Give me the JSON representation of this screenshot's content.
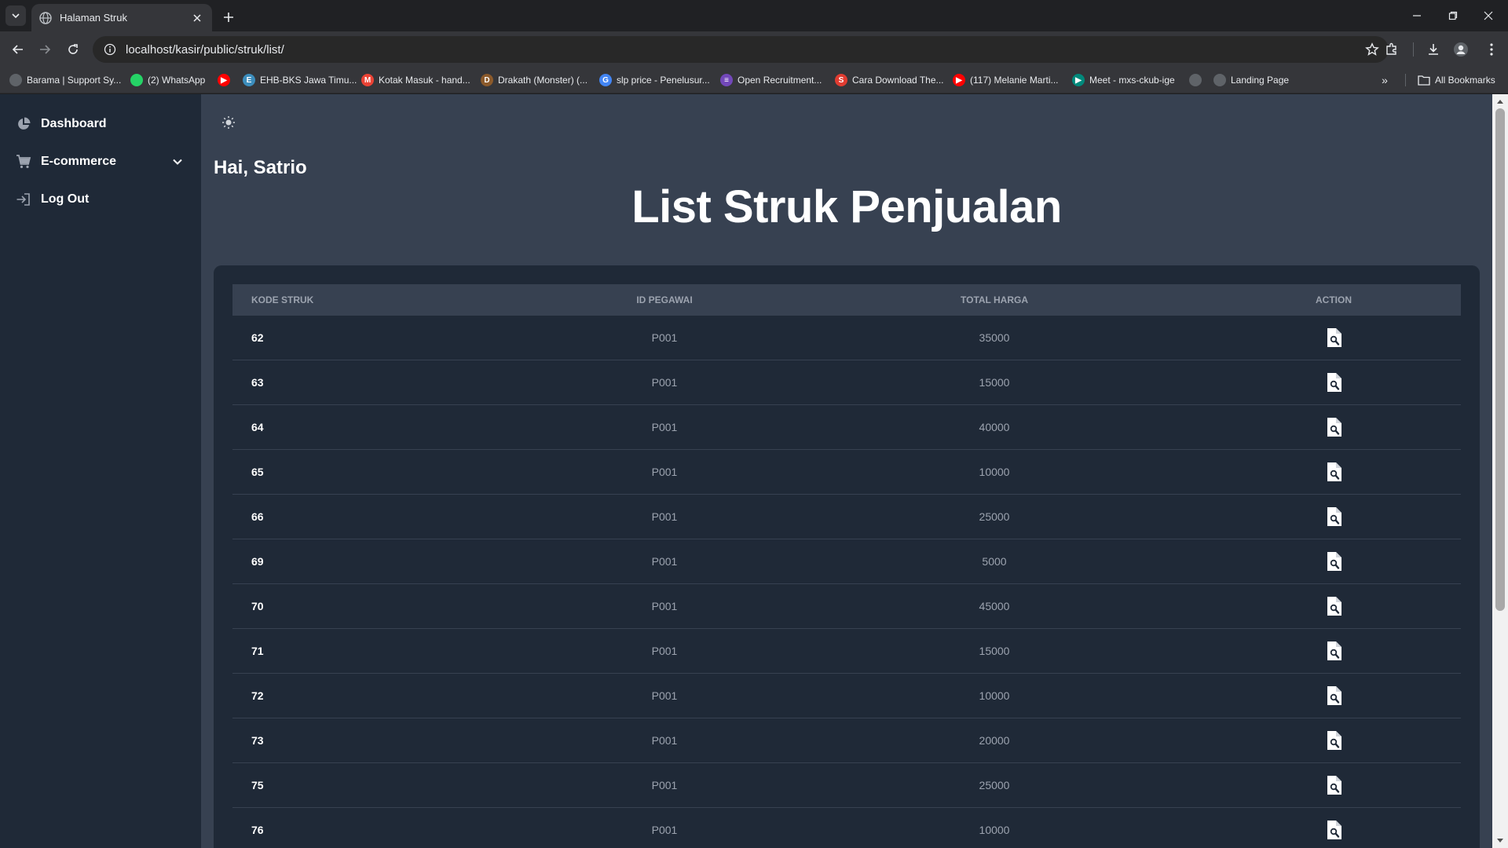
{
  "browser": {
    "tab_title": "Halaman Struk",
    "url": "localhost/kasir/public/struk/list/",
    "bookmarks": [
      {
        "label": "Barama | Support Sy...",
        "icon": "globe-icon",
        "color": "#5f6368"
      },
      {
        "label": "(2) WhatsApp",
        "icon": "whatsapp-icon",
        "color": "#25d366"
      },
      {
        "label": "",
        "icon": "youtube-icon",
        "color": "#ff0000"
      },
      {
        "label": "EHB-BKS Jawa Timu...",
        "icon": "site-icon",
        "color": "#3c8dbc"
      },
      {
        "label": "Kotak Masuk - hand...",
        "icon": "gmail-icon",
        "color": "#ea4335"
      },
      {
        "label": "Drakath (Monster) (...",
        "icon": "game-icon",
        "color": "#8b5a2b"
      },
      {
        "label": "slp price - Penelusur...",
        "icon": "google-icon",
        "color": "#4285f4"
      },
      {
        "label": "Open Recruitment...",
        "icon": "forms-icon",
        "color": "#7248b9"
      },
      {
        "label": "Cara Download The...",
        "icon": "s-icon",
        "color": "#e03c31"
      },
      {
        "label": "(117) Melanie Marti...",
        "icon": "youtube-icon",
        "color": "#ff0000"
      },
      {
        "label": "Meet - mxs-ckub-ige",
        "icon": "meet-icon",
        "color": "#00897b"
      },
      {
        "label": "",
        "icon": "globe-icon",
        "color": "#5f6368"
      },
      {
        "label": "Landing Page",
        "icon": "globe-icon",
        "color": "#5f6368"
      }
    ],
    "all_bookmarks_label": "All Bookmarks"
  },
  "sidebar": {
    "items": [
      {
        "label": "Dashboard",
        "icon": "pie-chart-icon"
      },
      {
        "label": "E-commerce",
        "icon": "cart-icon"
      },
      {
        "label": "Log Out",
        "icon": "logout-icon"
      }
    ]
  },
  "main": {
    "greeting": "Hai, Satrio",
    "title": "List Struk Penjualan",
    "table": {
      "headers": [
        "Kode Struk",
        "ID Pegawai",
        "Total Harga",
        "Action"
      ],
      "rows": [
        {
          "kode": "62",
          "pegawai": "P001",
          "total": "35000"
        },
        {
          "kode": "63",
          "pegawai": "P001",
          "total": "15000"
        },
        {
          "kode": "64",
          "pegawai": "P001",
          "total": "40000"
        },
        {
          "kode": "65",
          "pegawai": "P001",
          "total": "10000"
        },
        {
          "kode": "66",
          "pegawai": "P001",
          "total": "25000"
        },
        {
          "kode": "69",
          "pegawai": "P001",
          "total": "5000"
        },
        {
          "kode": "70",
          "pegawai": "P001",
          "total": "45000"
        },
        {
          "kode": "71",
          "pegawai": "P001",
          "total": "15000"
        },
        {
          "kode": "72",
          "pegawai": "P001",
          "total": "10000"
        },
        {
          "kode": "73",
          "pegawai": "P001",
          "total": "20000"
        },
        {
          "kode": "75",
          "pegawai": "P001",
          "total": "25000"
        },
        {
          "kode": "76",
          "pegawai": "P001",
          "total": "10000"
        }
      ]
    }
  },
  "colors": {
    "sidebar_bg": "#1f2937",
    "main_bg": "#374151",
    "card_bg": "#1f2937",
    "header_text": "#9ca3af"
  }
}
